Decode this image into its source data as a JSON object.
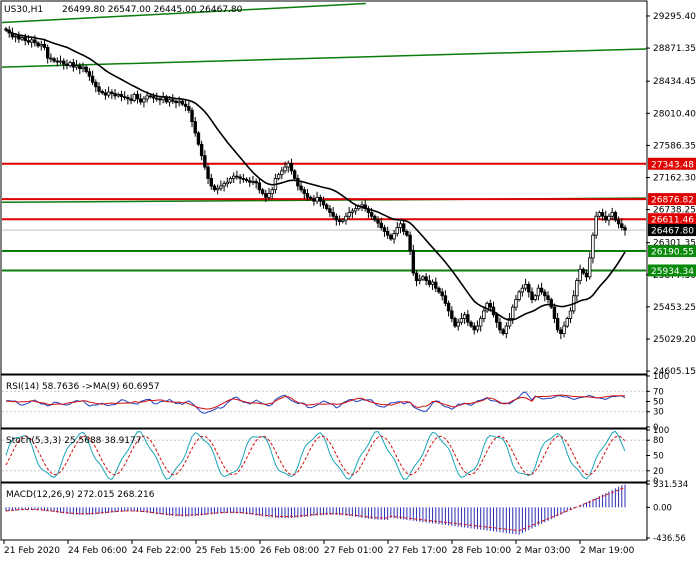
{
  "header": {
    "symbol": "US30,H1",
    "ohlc": "26499.80 26547.00 26445.00 26467.80"
  },
  "colors": {
    "bull": "#000000",
    "bear": "#000000",
    "ma_line": "#000000",
    "support": "#0a7d0a",
    "resistance": "#e00000",
    "label_green": "#0a8a0a",
    "label_red": "#e00000",
    "current_price_bg": "#000000",
    "rsi_line": "#1f3fbf",
    "rsi_ma": "#d01010",
    "stoch_main": "#1aa5b8",
    "stoch_signal": "#d01010",
    "macd_hist": "#2b2bb3",
    "macd_signal": "#d01010",
    "grid": "#c8c8c8"
  },
  "chart_data": [
    {
      "type": "candlestick",
      "title": "US30,H1",
      "ylim": [
        24580,
        29480
      ],
      "y_ticks": [
        "29295.40",
        "28871.35",
        "28434.45",
        "28010.40",
        "27586.35",
        "27162.30",
        "26738.25",
        "26301.35",
        "25877.30",
        "25453.25",
        "25029.20",
        "24605.15"
      ],
      "x_ticks": [
        "21 Feb 2020",
        "24 Feb 06:00",
        "24 Feb 22:00",
        "25 Feb 15:00",
        "26 Feb 08:00",
        "27 Feb 01:00",
        "27 Feb 17:00",
        "28 Feb 10:00",
        "2 Mar 03:00",
        "2 Mar 19:00"
      ],
      "current_price": "26467.80",
      "levels": [
        {
          "price": 27343.48,
          "label": "27343.48",
          "kind": "resistance"
        },
        {
          "price": 26876.82,
          "label": "26876.82",
          "kind": "resistance"
        },
        {
          "price": 26611.46,
          "label": "26611.46",
          "kind": "resistance"
        },
        {
          "price": 26190.55,
          "label": "26190.55",
          "kind": "support"
        },
        {
          "price": 25934.34,
          "label": "25934.34",
          "kind": "support"
        }
      ],
      "trendlines": [
        {
          "x1": 0.0,
          "y1": 29210,
          "x2": 0.565,
          "y2": 29460
        },
        {
          "x1": 0.0,
          "y1": 28620,
          "x2": 1.0,
          "y2": 28860
        },
        {
          "x1": 0.0,
          "y1": 26835,
          "x2": 1.0,
          "y2": 26890
        }
      ],
      "closes": [
        29110,
        29070,
        29020,
        29030,
        28990,
        29010,
        28970,
        28950,
        28980,
        28940,
        28900,
        28920,
        28880,
        28740,
        28730,
        28700,
        28690,
        28700,
        28660,
        28640,
        28680,
        28620,
        28640,
        28600,
        28620,
        28560,
        28500,
        28420,
        28360,
        28300,
        28280,
        28250,
        28290,
        28270,
        28240,
        28260,
        28230,
        28220,
        28200,
        28180,
        28260,
        28200,
        28160,
        28200,
        28240,
        28230,
        28210,
        28200,
        28190,
        28230,
        28160,
        28190,
        28170,
        28150,
        28170,
        28130,
        28100,
        28050,
        27900,
        27750,
        27600,
        27450,
        27300,
        27150,
        27050,
        27000,
        27020,
        27050,
        27080,
        27100,
        27150,
        27180,
        27170,
        27150,
        27140,
        27120,
        27100,
        27110,
        27090,
        27000,
        26950,
        26900,
        26950,
        27000,
        27150,
        27200,
        27250,
        27300,
        27350,
        27250,
        27150,
        27050,
        27000,
        26950,
        26900,
        26880,
        26850,
        26900,
        26850,
        26800,
        26750,
        26700,
        26650,
        26600,
        26580,
        26600,
        26650,
        26700,
        26720,
        26750,
        26780,
        26800,
        26750,
        26700,
        26650,
        26600,
        26560,
        26500,
        26450,
        26400,
        26350,
        26420,
        26500,
        26550,
        26450,
        26400,
        26200,
        25900,
        25800,
        25820,
        25850,
        25800,
        25750,
        25780,
        25700,
        25650,
        25600,
        25500,
        25400,
        25300,
        25200,
        25250,
        25300,
        25350,
        25250,
        25200,
        25150,
        25200,
        25300,
        25400,
        25500,
        25450,
        25350,
        25250,
        25150,
        25100,
        25200,
        25300,
        25450,
        25550,
        25650,
        25700,
        25750,
        25650,
        25550,
        25600,
        25700,
        25650,
        25600,
        25550,
        25450,
        25300,
        25150,
        25100,
        25200,
        25300,
        25400,
        25600,
        25800,
        25950,
        25900,
        25850,
        26100,
        26400,
        26650,
        26700,
        26650,
        26600,
        26650,
        26700,
        26600,
        26550,
        26500,
        26467.8
      ],
      "ma_period": 20
    },
    {
      "type": "line",
      "title": "RSI(14) 58.7636 ->MA(9) 60.6957",
      "ylim": [
        0,
        100
      ],
      "y_ticks": [
        "100",
        "70",
        "50",
        "30",
        "0"
      ],
      "levels": [
        70,
        30
      ],
      "series": [
        {
          "name": "RSI(14)"
        },
        {
          "name": "MA(9)"
        }
      ]
    },
    {
      "type": "line",
      "title": "Stoch(5,3,3) 25.5688 38.9177",
      "ylim": [
        0,
        100
      ],
      "y_ticks": [
        "100",
        "80",
        "50",
        "20",
        "0"
      ],
      "levels": [
        80,
        20
      ],
      "series": [
        {
          "name": "Stoch main"
        },
        {
          "name": "Stoch signal"
        }
      ]
    },
    {
      "type": "bar",
      "title": "MACD(12,26,9) 272.015 268.216",
      "ylim": [
        -436.56,
        331.534
      ],
      "y_ticks": [
        "331.534",
        "0.00",
        "-436.56"
      ],
      "series": [
        {
          "name": "MACD histogram"
        },
        {
          "name": "Signal"
        }
      ]
    }
  ]
}
